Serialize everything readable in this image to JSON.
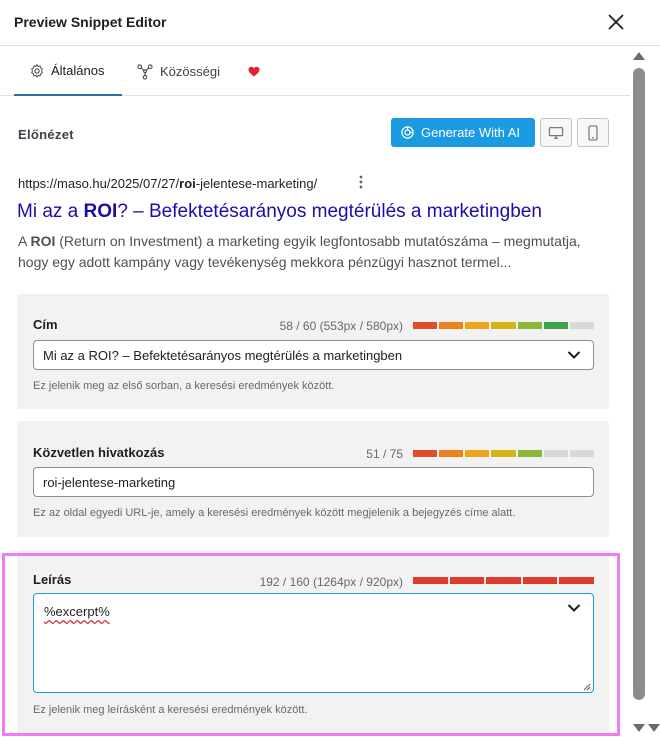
{
  "window": {
    "title": "Preview Snippet Editor"
  },
  "tabs": [
    {
      "label": "Általános",
      "active": true
    },
    {
      "label": "Közösségi",
      "active": false
    }
  ],
  "preview": {
    "heading": "Előnézet",
    "ai_button": "Generate With AI",
    "url_prefix": "https://maso.hu/2025/07/27/",
    "url_bold": "roi",
    "url_suffix": "-jelentese-marketing/",
    "title_pre": "Mi az a ",
    "title_bold": "ROI",
    "title_post": "? – Befektetésarányos megtérülés a marketingben",
    "desc_pre": "A ",
    "desc_bold": "ROI",
    "desc_post": " (Return on Investment) a marketing egyik legfontosabb mutatószáma – megmutatja, hogy egy adott kampány vagy tevékenység mekkora pénzügyi hasznot termel..."
  },
  "fields": {
    "title": {
      "label": "Cím",
      "counter": "58 / 60 (553px / 580px)",
      "value": "Mi az a ROI? – Befektetésarányos megtérülés a marketingben",
      "help": "Ez jelenik meg az első sorban, a keresési eredmények között.",
      "meter_fraction": 0.96
    },
    "permalink": {
      "label": "Közvetlen hivatkozás",
      "counter": "51 / 75",
      "value": "roi-jelentese-marketing",
      "help": "Ez az oldal egyedi URL-je, amely a keresési eredmények között megjelenik a bejegyzés címe alatt.",
      "meter_fraction": 0.68
    },
    "description": {
      "label": "Leírás",
      "counter": "192 / 160 (1264px / 920px)",
      "value": "%excerpt%",
      "help": "Ez jelenik meg leírásként a keresési eredmények között.",
      "meter_fraction": 1.0
    }
  },
  "colors": {
    "accent": "#1a9ae0",
    "link": "#1a0dab",
    "heart": "#e0272d",
    "highlight": "#f07cf3"
  }
}
